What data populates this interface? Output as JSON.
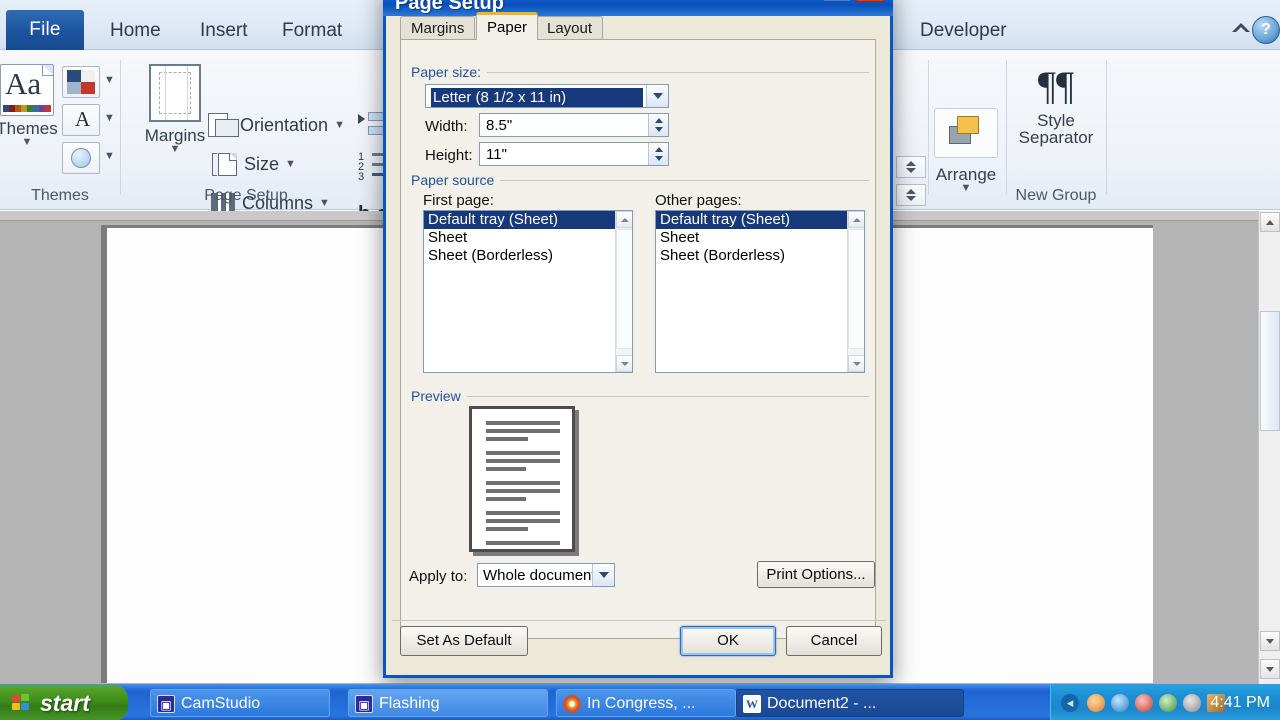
{
  "app": {
    "ribbon_tabs": [
      {
        "label": "File",
        "active": false,
        "is_file": true
      },
      {
        "label": "Home",
        "active": false
      },
      {
        "label": "Insert",
        "active": false
      },
      {
        "label": "Format",
        "active": false
      },
      {
        "label": "Developer",
        "active": false
      }
    ],
    "groups": {
      "themes": {
        "label": "Themes",
        "main_button": "Themes",
        "swatch_colors": [
          "#2a4b7c",
          "#7e1f1f",
          "#b8541a",
          "#b79a1f",
          "#3d7a33",
          "#2f6fa3",
          "#7a3f8f",
          "#c0392b"
        ]
      },
      "page_setup": {
        "label": "Page Setup",
        "margins_button": "Margins",
        "commands": [
          "Orientation",
          "Size",
          "Columns"
        ]
      },
      "arrange": {
        "label": "Arrange",
        "button": "Arrange"
      },
      "new_group": {
        "label": "New Group",
        "button_line1": "Style",
        "button_line2": "Separator"
      }
    },
    "help_icon": "help-orb-icon",
    "collapse_icon": "collapse-ribbon-icon"
  },
  "dialog": {
    "title": "Page Setup",
    "minimize_label": "?",
    "close_label": "✕",
    "tabs": [
      {
        "label": "Margins",
        "active": false
      },
      {
        "label": "Paper",
        "active": true
      },
      {
        "label": "Layout",
        "active": false
      }
    ],
    "paper_size": {
      "group_label": "Paper size:",
      "selected": "Letter (8 1/2 x 11 in)",
      "width_label": "Width:",
      "width_value": "8.5\"",
      "height_label": "Height:",
      "height_value": "11\""
    },
    "paper_source": {
      "group_label": "Paper source",
      "first_page_label": "First page:",
      "other_pages_label": "Other pages:",
      "first_page_items": [
        "Default tray (Sheet)",
        "Sheet",
        "Sheet (Borderless)"
      ],
      "first_page_selected_index": 0,
      "other_pages_items": [
        "Default tray (Sheet)",
        "Sheet",
        "Sheet (Borderless)"
      ],
      "other_pages_selected_index": 0
    },
    "preview": {
      "group_label": "Preview",
      "apply_to_label": "Apply to:",
      "apply_to_value": "Whole document",
      "print_options_label": "Print Options..."
    },
    "footer": {
      "set_as_default": "Set As Default",
      "ok": "OK",
      "cancel": "Cancel"
    }
  },
  "taskbar": {
    "start_label": "start",
    "tasks": [
      {
        "label": "CamStudio",
        "icon": "camstudio-icon",
        "state": "normal"
      },
      {
        "label": "Flashing",
        "icon": "camstudio-icon",
        "state": "light"
      },
      {
        "label": "In Congress, ...",
        "icon": "chrome-icon",
        "state": "normal"
      },
      {
        "label": "Document2 - ...",
        "icon": "word-icon",
        "state": "active"
      }
    ],
    "clock": "4:41 PM"
  },
  "colors": {
    "title_blue": "#0c59c8",
    "accent_orange": "#f0b429",
    "selection_blue": "#17397c",
    "dialog_face": "#f2f0e9",
    "taskbar_blue": "#1e64d2",
    "start_green": "#3f8f1c"
  }
}
